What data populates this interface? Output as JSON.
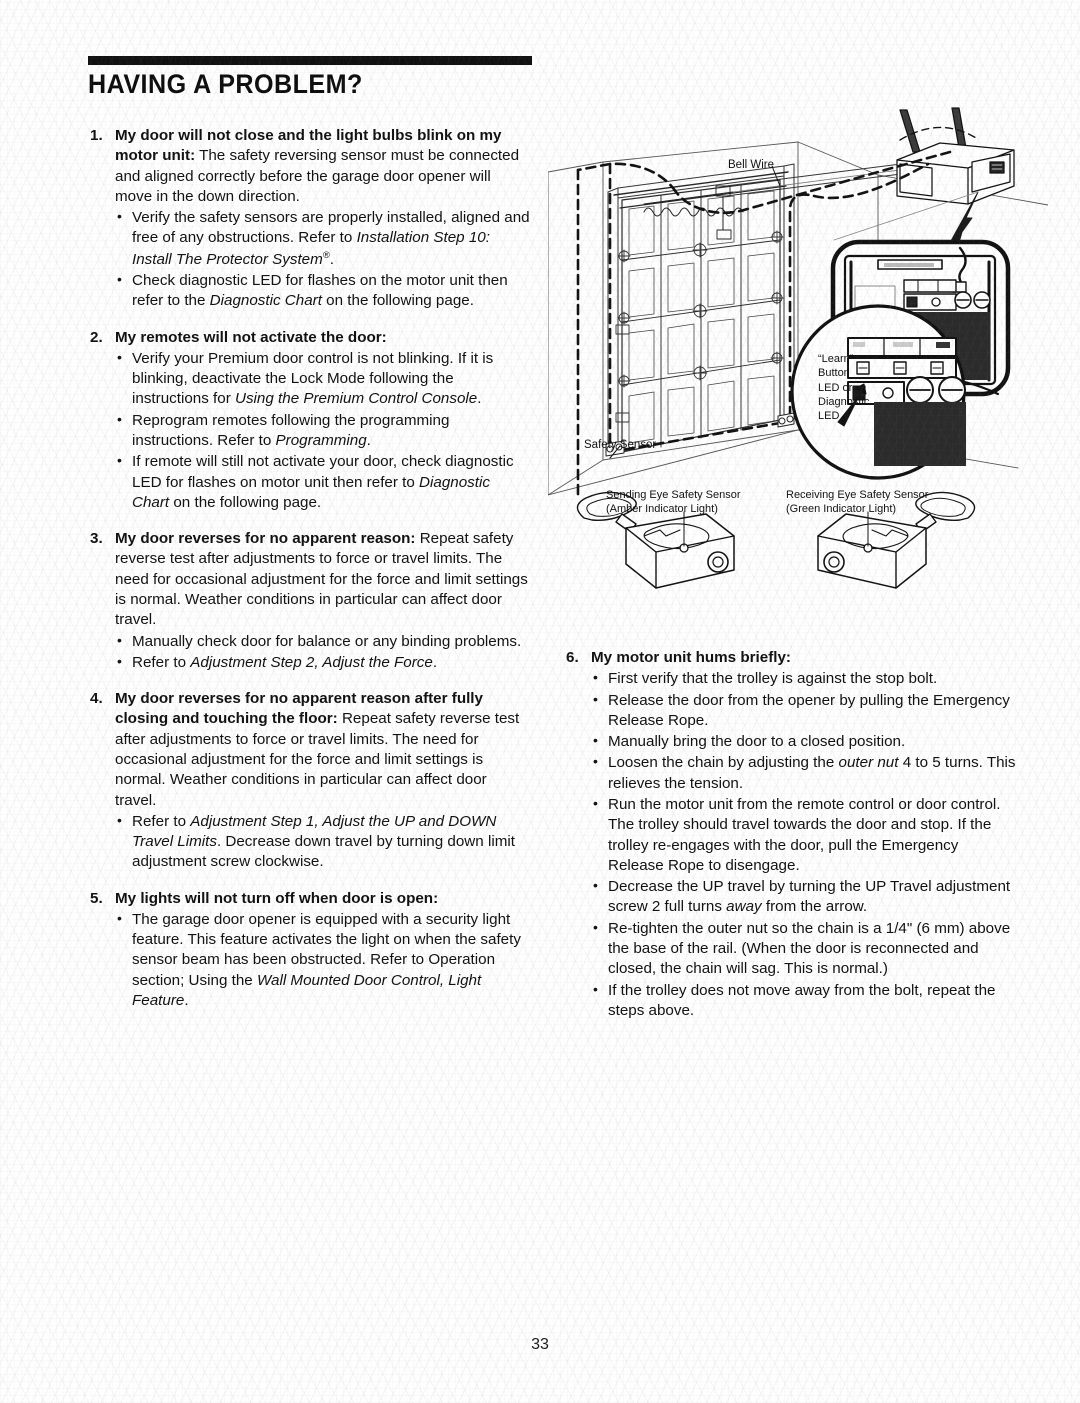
{
  "document": {
    "title": "HAVING A PROBLEM?",
    "page_number": "33"
  },
  "problems": [
    {
      "number": "1.",
      "heading": "My door will not close and the light bulbs blink on my motor unit:",
      "lead_rest": " The safety reversing sensor must be connected and aligned correctly before the garage door opener will move in the down direction.",
      "bullets": [
        {
          "pre": "Verify the safety sensors are properly installed, aligned and free of any obstructions. Refer to ",
          "em": "Installation Step 10: Install The Protector System",
          "sup": "®",
          "post": "."
        },
        {
          "pre": "Check diagnostic LED for flashes on the motor unit then refer to the ",
          "em": "Diagnostic Chart",
          "post": " on the following page."
        }
      ]
    },
    {
      "number": "2.",
      "heading": "My remotes will not activate the door:",
      "lead_rest": "",
      "bullets": [
        {
          "pre": "Verify your Premium door control is not blinking. If it is blinking, deactivate the Lock Mode following the instructions for ",
          "em": "Using the Premium Control Console",
          "post": "."
        },
        {
          "pre": "Reprogram remotes following the programming instructions. Refer to ",
          "em": "Programming",
          "post": "."
        },
        {
          "pre": "If remote will still not activate your door, check diagnostic LED for flashes on motor unit then refer to ",
          "em": "Diagnostic Chart",
          "post": " on the following page."
        }
      ]
    },
    {
      "number": "3.",
      "heading": "My door reverses for no apparent reason:",
      "lead_rest": " Repeat safety reverse test after adjustments to force or travel limits. The need for occasional adjustment for the force and limit settings is normal. Weather conditions in particular can affect door travel.",
      "bullets": [
        {
          "pre": "Manually check door for balance or any binding problems.",
          "em": "",
          "post": ""
        },
        {
          "pre": "Refer to ",
          "em": "Adjustment Step 2, Adjust the Force",
          "post": "."
        }
      ]
    },
    {
      "number": "4.",
      "heading": "My door reverses for no apparent reason after fully closing and touching the floor:",
      "lead_rest": " Repeat safety reverse test after adjustments to force or travel limits. The need for occasional adjustment for the force and limit settings is normal. Weather conditions in particular can affect door travel.",
      "bullets": [
        {
          "pre": "Refer to ",
          "em": "Adjustment Step 1, Adjust the UP and DOWN Travel Limits",
          "post": ". Decrease down travel by turning down limit adjustment screw clockwise."
        }
      ]
    },
    {
      "number": "5.",
      "heading": "My lights will not turn off when door is open:",
      "lead_rest": "",
      "bullets": [
        {
          "pre": "The garage door opener is equipped with a security light feature. This feature activates the light on when the safety sensor beam has been obstructed. Refer to Operation section; Using the ",
          "em": "Wall Mounted Door Control, Light Feature",
          "post": "."
        }
      ]
    },
    {
      "number": "6.",
      "heading": "My motor unit hums briefly:",
      "lead_rest": "",
      "bullets": [
        {
          "pre": "First verify that the trolley is against the stop bolt.",
          "em": "",
          "post": ""
        },
        {
          "pre": "Release the door from the opener by pulling the Emergency Release Rope.",
          "em": "",
          "post": ""
        },
        {
          "pre": "Manually bring the door to a closed position.",
          "em": "",
          "post": ""
        },
        {
          "pre": "Loosen the chain by adjusting the ",
          "em": "outer nut",
          "post": " 4 to 5 turns. This relieves the tension."
        },
        {
          "pre": "Run the motor unit from the remote control or door control. The trolley should travel towards the door and stop. If the trolley re-engages with the door, pull the Emergency Release Rope to disengage.",
          "em": "",
          "post": ""
        },
        {
          "pre": "Decrease the UP travel by turning the UP Travel adjustment screw 2 full turns ",
          "em": "away",
          "post": " from the arrow."
        },
        {
          "pre": "Re-tighten the outer nut so the chain is a 1/4\" (6 mm) above the base of the rail. (When the door is reconnected and closed, the chain will sag. This is normal.)",
          "em": "",
          "post": ""
        },
        {
          "pre": "If the trolley does not move away from the bolt, repeat the steps above.",
          "em": "",
          "post": ""
        }
      ]
    }
  ],
  "figure": {
    "name": "garage-door-opener-installation-diagram",
    "labels": {
      "bell_wire": "Bell Wire",
      "safety_sensor": "Safety Sensor",
      "learn_button_line1": "“Learn”",
      "learn_button_line2": "Button",
      "learn_button_line3": "LED or",
      "learn_button_line4": "Diagnostic",
      "learn_button_line5": "LED",
      "sending_eye_line1": "Sending Eye Safety Sensor",
      "sending_eye_line2": "(Amber Indicator Light)",
      "receiving_eye_line1": "Receiving Eye Safety Sensor",
      "receiving_eye_line2": "(Green Indicator Light)"
    }
  }
}
